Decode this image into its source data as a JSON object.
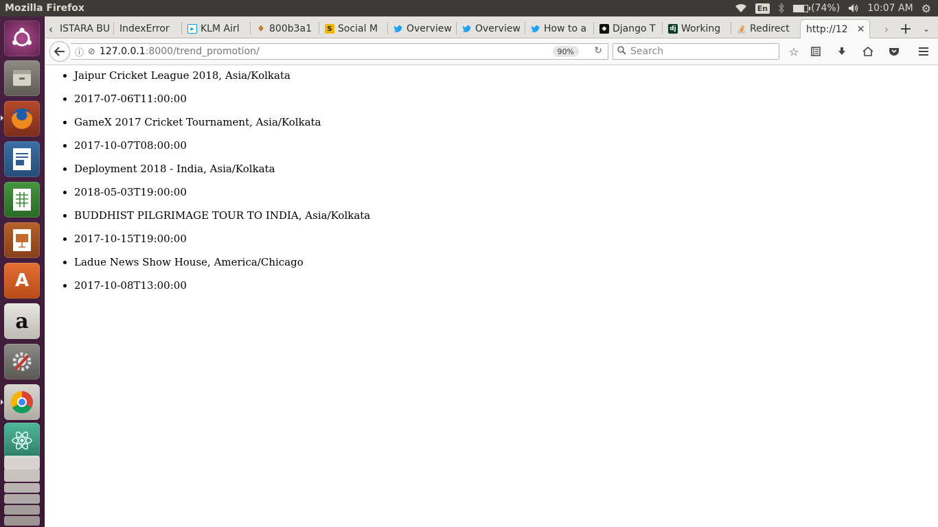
{
  "top_panel": {
    "window_title": "Mozilla Firefox",
    "keyboard_layout": "En",
    "battery_text": "(74%)",
    "battery_level": 0.74,
    "clock": "10:07 AM",
    "icons": [
      "wifi-icon",
      "bluetooth-icon",
      "battery-icon",
      "volume-icon",
      "settings-gear-icon"
    ]
  },
  "launcher": {
    "items": [
      "ubuntu-dash",
      "files",
      "firefox",
      "libreoffice-writer",
      "libreoffice-calc",
      "libreoffice-impress",
      "software-center",
      "amazon",
      "system-settings",
      "chrome",
      "atom",
      "workspaces"
    ]
  },
  "tabs": [
    {
      "label": "ISTARA BU",
      "icon": "none"
    },
    {
      "label": "IndexError",
      "icon": "none"
    },
    {
      "label": "KLM Airl",
      "icon": "klm-icon"
    },
    {
      "label": "800b3a1",
      "icon": "pin-icon"
    },
    {
      "label": "Social M",
      "icon": "s-icon"
    },
    {
      "label": "Overview",
      "icon": "twitter-icon"
    },
    {
      "label": "Overview",
      "icon": "twitter-icon"
    },
    {
      "label": "How to a",
      "icon": "twitter-icon"
    },
    {
      "label": "Django T",
      "icon": "django-icon"
    },
    {
      "label": "Working",
      "icon": "dj-icon"
    },
    {
      "label": "Redirect",
      "icon": "stackoverflow-icon"
    },
    {
      "label": "http://12",
      "icon": "none",
      "active": true
    }
  ],
  "navbar": {
    "url_host": "127.0.0.1",
    "url_rest": ":8000/trend_promotion/",
    "zoom": "90%",
    "search_placeholder": "Search"
  },
  "content": {
    "items": [
      "Jaipur Cricket League 2018, Asia/Kolkata",
      "2017-07-06T11:00:00",
      "GameX 2017 Cricket Tournament, Asia/Kolkata",
      "2017-10-07T08:00:00",
      "Deployment 2018 - India, Asia/Kolkata",
      "2018-05-03T19:00:00",
      "BUDDHIST PILGRIMAGE TOUR TO INDIA, Asia/Kolkata",
      "2017-10-15T19:00:00",
      "Ladue News Show House, America/Chicago",
      "2017-10-08T13:00:00"
    ]
  }
}
